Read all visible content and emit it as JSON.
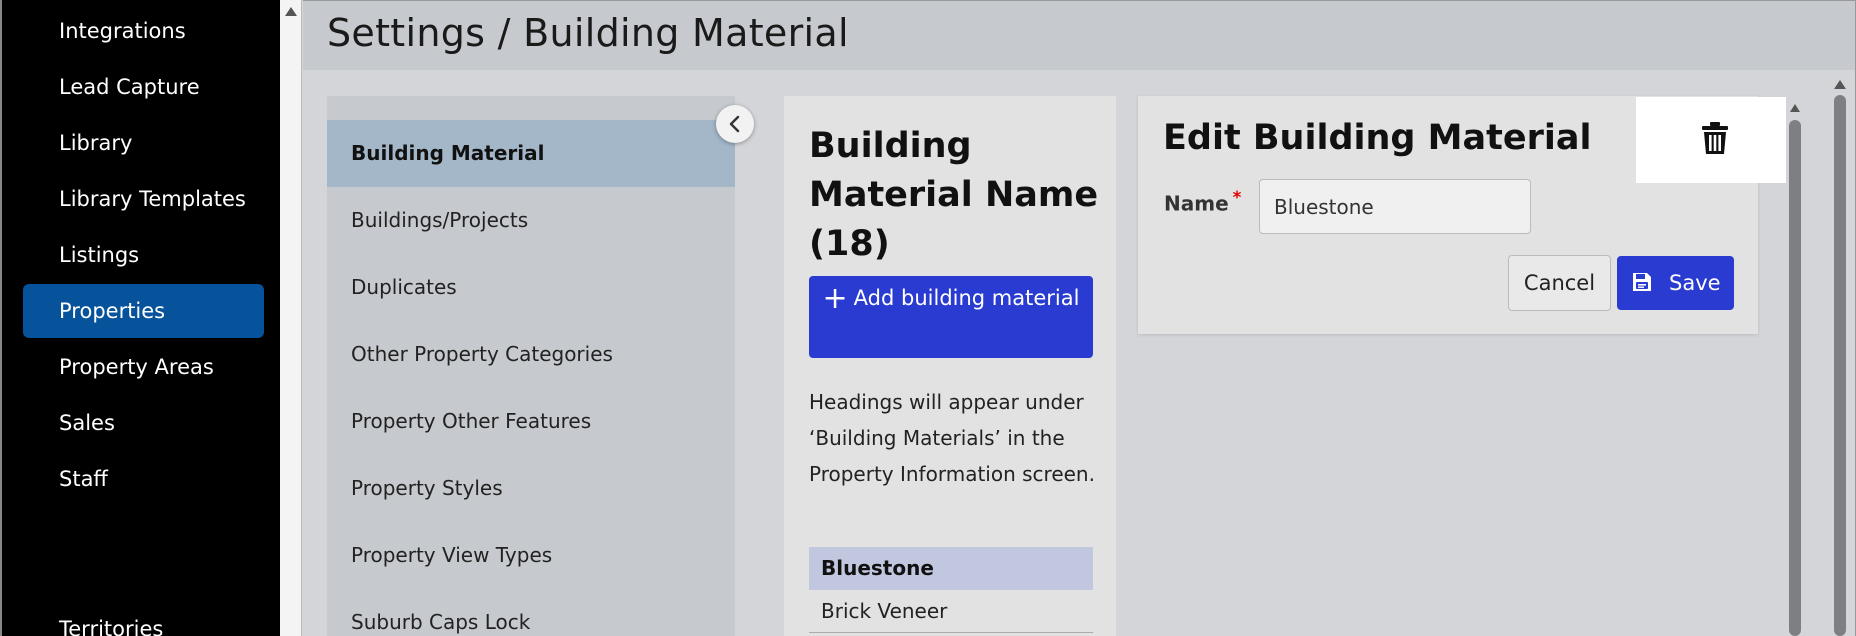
{
  "nav": {
    "items": [
      {
        "label": "Integrations",
        "active": false
      },
      {
        "label": "Lead Capture",
        "active": false
      },
      {
        "label": "Library",
        "active": false
      },
      {
        "label": "Library Templates",
        "active": false
      },
      {
        "label": "Listings",
        "active": false
      },
      {
        "label": "Properties",
        "active": true
      },
      {
        "label": "Property Areas",
        "active": false
      },
      {
        "label": "Sales",
        "active": false
      },
      {
        "label": "Staff",
        "active": false
      },
      {
        "label": "Territories",
        "active": false
      }
    ]
  },
  "header": {
    "title": "Settings / Building Material"
  },
  "categories": {
    "items": [
      {
        "label": "Building Material",
        "active": true
      },
      {
        "label": "Buildings/Projects",
        "active": false
      },
      {
        "label": "Duplicates",
        "active": false
      },
      {
        "label": "Other Property Categories",
        "active": false
      },
      {
        "label": "Property Other Features",
        "active": false
      },
      {
        "label": "Property Styles",
        "active": false
      },
      {
        "label": "Property View Types",
        "active": false
      },
      {
        "label": "Suburb Caps Lock",
        "active": false
      }
    ]
  },
  "list": {
    "title": "Building Material Name (18)",
    "add_button_label": "Add building material",
    "help_text": "Headings will appear under ‘Building Materials’ in the Property Information screen.",
    "rows": [
      {
        "label": "Bluestone",
        "selected": true
      },
      {
        "label": "Brick Veneer",
        "selected": false
      }
    ]
  },
  "edit": {
    "title": "Edit Building Material",
    "name_label": "Name",
    "required_mark": "*",
    "name_value": "Bluestone",
    "cancel_label": "Cancel",
    "save_label": "Save"
  },
  "icons": {
    "trash": "trash-icon",
    "save": "floppy-disk-icon",
    "plus": "plus-icon",
    "collapse": "chevron-left-icon"
  },
  "colors": {
    "primary": "#2a3bd1",
    "nav_active": "#06529b",
    "category_active": "#a3b7c8",
    "list_selected": "#c1c7de",
    "required": "#dd0000"
  }
}
